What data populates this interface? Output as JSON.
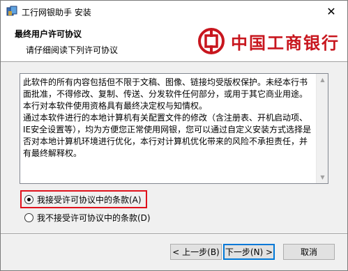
{
  "window": {
    "title": "工行网银助手 安装",
    "close_glyph": "✕"
  },
  "header": {
    "title": "最终用户许可协议",
    "subtitle": "请仔细阅读下列许可协议"
  },
  "logo": {
    "text": "中国工商银行",
    "color": "#c8161e",
    "icon": "icbc-logo-icon"
  },
  "license": {
    "text": "此软件的所有内容包括但不限于文稿、图像、链接均受版权保护。未经本行书面批准，不得修改、复制、传送、分发软件任何部分，或用于其它商业用途。本行对本软件使用资格具有最终决定权与知情权。\n通过本软件进行的本地计算机有关配置文件的修改（含注册表、开机启动项、IE安全设置等），均为方便您正常使用网银，您可以通过自定义安装方式选择是否对本地计算机环境进行优化，本行对计算机优化带来的风险不承担责任，并有最终解释权。"
  },
  "options": {
    "accept_label": "我接受许可协议中的条款(A)",
    "decline_label": "我不接受许可协议中的条款(D)",
    "selected": "accept"
  },
  "buttons": {
    "back_label": "< 上一步(B)",
    "next_label": "下一步(N) >",
    "cancel_label": "取消"
  },
  "colors": {
    "highlight": "#e0111b",
    "brand": "#c8161e"
  }
}
